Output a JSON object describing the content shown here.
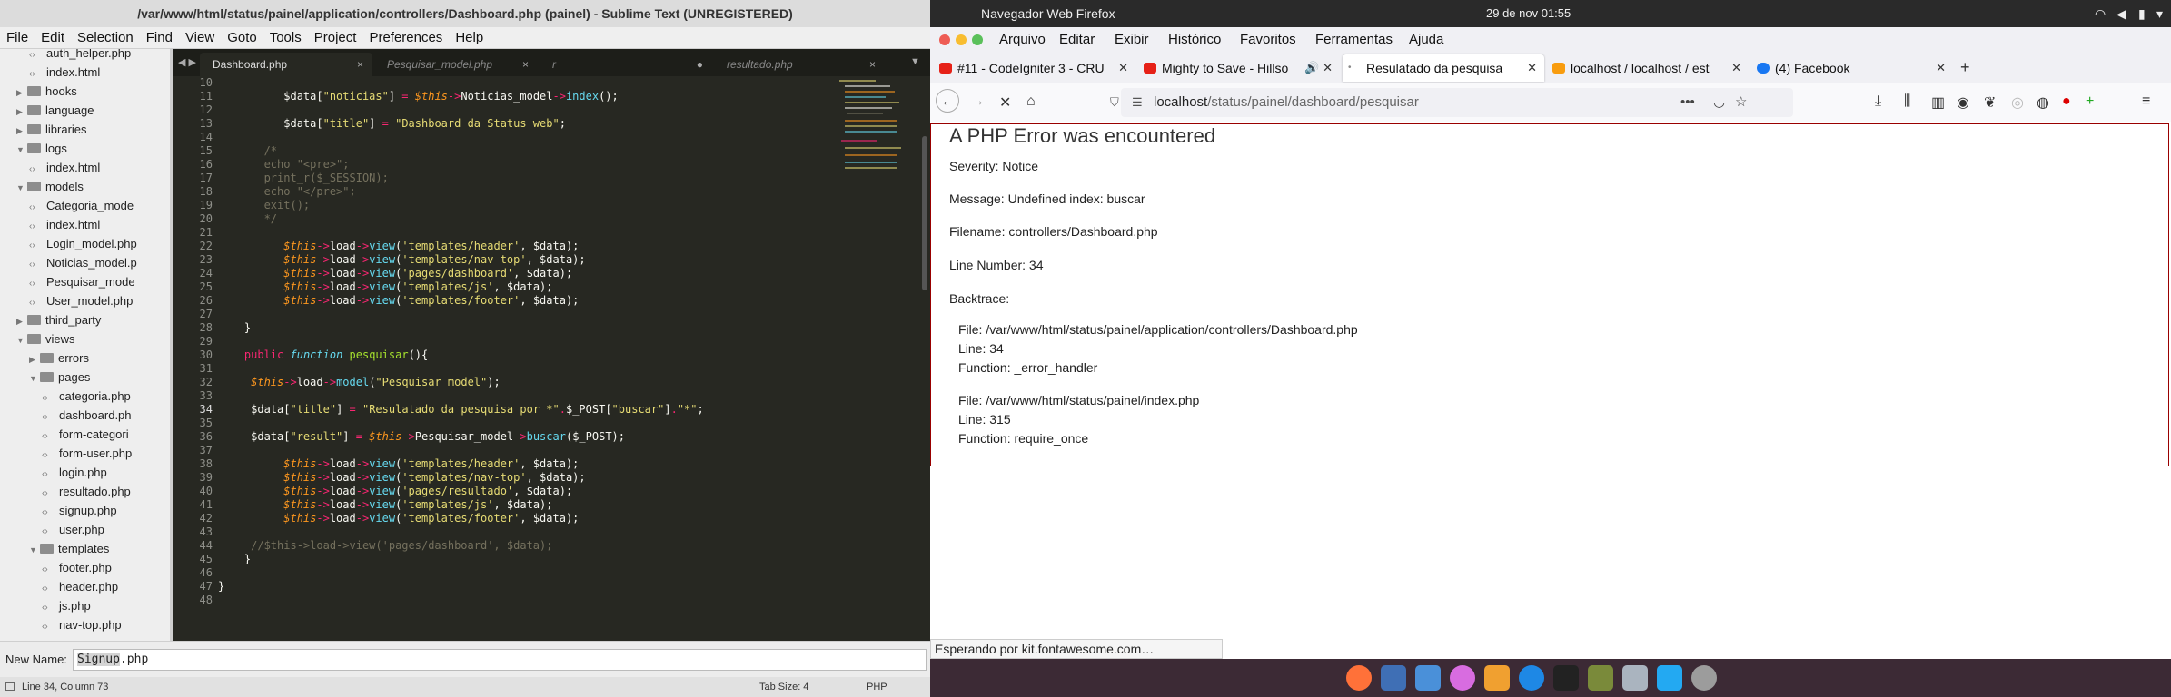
{
  "sublime": {
    "title": "/var/www/html/status/painel/application/controllers/Dashboard.php (painel) - Sublime Text (UNREGISTERED)",
    "menu": [
      "File",
      "Edit",
      "Selection",
      "Find",
      "View",
      "Goto",
      "Tools",
      "Project",
      "Preferences",
      "Help"
    ],
    "sidebar": [
      {
        "label": "auth_helper.php",
        "type": "file",
        "depth": 3
      },
      {
        "label": "index.html",
        "type": "file",
        "depth": 3
      },
      {
        "label": "hooks",
        "type": "folder",
        "depth": 2
      },
      {
        "label": "language",
        "type": "folder",
        "depth": 2
      },
      {
        "label": "libraries",
        "type": "folder",
        "depth": 2
      },
      {
        "label": "logs",
        "type": "folder-open",
        "depth": 2
      },
      {
        "label": "index.html",
        "type": "file",
        "depth": 3
      },
      {
        "label": "models",
        "type": "folder-open",
        "depth": 2
      },
      {
        "label": "Categoria_mode",
        "type": "file",
        "depth": 3
      },
      {
        "label": "index.html",
        "type": "file",
        "depth": 3
      },
      {
        "label": "Login_model.php",
        "type": "file",
        "depth": 3
      },
      {
        "label": "Noticias_model.p",
        "type": "file",
        "depth": 3
      },
      {
        "label": "Pesquisar_mode",
        "type": "file",
        "depth": 3
      },
      {
        "label": "User_model.php",
        "type": "file",
        "depth": 3
      },
      {
        "label": "third_party",
        "type": "folder",
        "depth": 2
      },
      {
        "label": "views",
        "type": "folder-open",
        "depth": 2
      },
      {
        "label": "errors",
        "type": "folder",
        "depth": 3
      },
      {
        "label": "pages",
        "type": "folder-open",
        "depth": 3
      },
      {
        "label": "categoria.php",
        "type": "file",
        "depth": 4
      },
      {
        "label": "dashboard.ph",
        "type": "file",
        "depth": 4
      },
      {
        "label": "form-categori",
        "type": "file",
        "depth": 4
      },
      {
        "label": "form-user.php",
        "type": "file",
        "depth": 4
      },
      {
        "label": "login.php",
        "type": "file",
        "depth": 4
      },
      {
        "label": "resultado.php",
        "type": "file",
        "depth": 4
      },
      {
        "label": "signup.php",
        "type": "file",
        "depth": 4
      },
      {
        "label": "user.php",
        "type": "file",
        "depth": 4
      },
      {
        "label": "templates",
        "type": "folder-open",
        "depth": 3
      },
      {
        "label": "footer.php",
        "type": "file",
        "depth": 4
      },
      {
        "label": "header.php",
        "type": "file",
        "depth": 4
      },
      {
        "label": "js.php",
        "type": "file",
        "depth": 4
      },
      {
        "label": "nav-top.php",
        "type": "file",
        "depth": 4
      }
    ],
    "tabs": [
      {
        "label": "Dashboard.php",
        "active": true,
        "close": "×"
      },
      {
        "label": "Pesquisar_model.php",
        "active": false,
        "close": "×"
      },
      {
        "label": "r",
        "active": false,
        "close": "●"
      },
      {
        "label": "resultado.php",
        "active": false,
        "close": "×"
      }
    ],
    "line_numbers": [
      "10",
      "11",
      "12",
      "13",
      "14",
      "15",
      "16",
      "17",
      "18",
      "19",
      "20",
      "21",
      "22",
      "23",
      "24",
      "25",
      "26",
      "27",
      "28",
      "29",
      "30",
      "31",
      "32",
      "33",
      "34",
      "35",
      "36",
      "37",
      "38",
      "39",
      "40",
      "41",
      "42",
      "43",
      "44",
      "45",
      "46",
      "47",
      "48"
    ],
    "new_name_label": "New Name:",
    "new_name_selected": "Signup",
    "new_name_rest": ".php",
    "status_left": "Line 34, Column 73",
    "status_tab": "Tab Size: 4",
    "status_syntax": "PHP"
  },
  "firefox": {
    "app_name": "Navegador Web Firefox",
    "datetime": "29 de nov  01:55",
    "menu": [
      "Arquivo",
      "Editar",
      "Exibir",
      "Histórico",
      "Favoritos",
      "Ferramentas",
      "Ajuda"
    ],
    "tabs": [
      {
        "label": "#11 - CodeIgniter 3 - CRU",
        "active": false,
        "icon_color": "#e62117"
      },
      {
        "label": "Mighty to Save - Hillso",
        "active": false,
        "icon_color": "#e62117"
      },
      {
        "label": "Resulatado da pesquisa",
        "active": true,
        "icon_color": "#888888"
      },
      {
        "label": "localhost / localhost / est",
        "active": false,
        "icon_color": "#f89c0e"
      },
      {
        "label": "(4) Facebook",
        "active": false,
        "icon_color": "#1877f2"
      }
    ],
    "url_host": "localhost",
    "url_path": "/status/painel/dashboard/pesquisar",
    "error": {
      "heading": "A PHP Error was encountered",
      "severity": "Severity: Notice",
      "message": "Message: Undefined index: buscar",
      "filename": "Filename: controllers/Dashboard.php",
      "line": "Line Number: 34",
      "backtrace_label": "Backtrace:",
      "backtrace": [
        {
          "file": "File: /var/www/html/status/painel/application/controllers/Dashboard.php",
          "line": "Line: 34",
          "function": "Function: _error_handler"
        },
        {
          "file": "File: /var/www/html/status/painel/index.php",
          "line": "Line: 315",
          "function": "Function: require_once"
        }
      ]
    },
    "status_text": "Esperando por kit.fontawesome.com…"
  }
}
